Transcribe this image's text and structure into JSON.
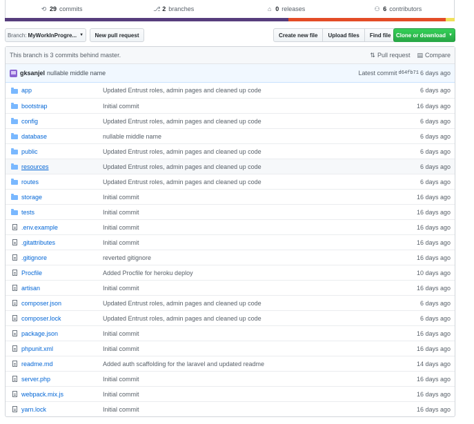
{
  "stats": {
    "commits_count": "29",
    "commits_label": "commits",
    "branches_count": "2",
    "branches_label": "branches",
    "releases_count": "0",
    "releases_label": "releases",
    "contributors_count": "6",
    "contributors_label": "contributors"
  },
  "language_bar": [
    {
      "color": "#563d7c",
      "fraction": 0.63
    },
    {
      "color": "#e34c26",
      "fraction": 0.35
    },
    {
      "color": "#f1e05a",
      "fraction": 0.02
    }
  ],
  "toolbar": {
    "branch_label": "Branch:",
    "branch_name": "MyWorkInProgre...",
    "new_pull_request": "New pull request",
    "create_new_file": "Create new file",
    "upload_files": "Upload files",
    "find_file": "Find file",
    "clone_download": "Clone or download"
  },
  "branch_status": {
    "text": "This branch is 3 commits behind master.",
    "pull_request": "Pull request",
    "compare": "Compare"
  },
  "latest_commit": {
    "author": "gksanjel",
    "message": "nullable middle name",
    "label": "Latest commit",
    "sha": "d64fb71",
    "age": "6 days ago"
  },
  "files": [
    {
      "type": "dir",
      "name": "app",
      "message": "Updated Entrust roles, admin pages and cleaned up code",
      "age": "6 days ago"
    },
    {
      "type": "dir",
      "name": "bootstrap",
      "message": "Initial commit",
      "age": "16 days ago"
    },
    {
      "type": "dir",
      "name": "config",
      "message": "Updated Entrust roles, admin pages and cleaned up code",
      "age": "6 days ago"
    },
    {
      "type": "dir",
      "name": "database",
      "message": "nullable middle name",
      "age": "6 days ago"
    },
    {
      "type": "dir",
      "name": "public",
      "message": "Updated Entrust roles, admin pages and cleaned up code",
      "age": "6 days ago"
    },
    {
      "type": "dir",
      "name": "resources",
      "message": "Updated Entrust roles, admin pages and cleaned up code",
      "age": "6 days ago"
    },
    {
      "type": "dir",
      "name": "routes",
      "message": "Updated Entrust roles, admin pages and cleaned up code",
      "age": "6 days ago"
    },
    {
      "type": "dir",
      "name": "storage",
      "message": "Initial commit",
      "age": "16 days ago"
    },
    {
      "type": "dir",
      "name": "tests",
      "message": "Initial commit",
      "age": "16 days ago"
    },
    {
      "type": "file",
      "name": ".env.example",
      "message": "Initial commit",
      "age": "16 days ago"
    },
    {
      "type": "file",
      "name": ".gitattributes",
      "message": "Initial commit",
      "age": "16 days ago"
    },
    {
      "type": "file",
      "name": ".gitignore",
      "message": "reverted gitignore",
      "age": "16 days ago"
    },
    {
      "type": "file",
      "name": "Procfile",
      "message": "Added Procfile for heroku deploy",
      "age": "10 days ago"
    },
    {
      "type": "file",
      "name": "artisan",
      "message": "Initial commit",
      "age": "16 days ago"
    },
    {
      "type": "file",
      "name": "composer.json",
      "message": "Updated Entrust roles, admin pages and cleaned up code",
      "age": "6 days ago"
    },
    {
      "type": "file",
      "name": "composer.lock",
      "message": "Updated Entrust roles, admin pages and cleaned up code",
      "age": "6 days ago"
    },
    {
      "type": "file",
      "name": "package.json",
      "message": "Initial commit",
      "age": "16 days ago"
    },
    {
      "type": "file",
      "name": "phpunit.xml",
      "message": "Initial commit",
      "age": "16 days ago"
    },
    {
      "type": "file",
      "name": "readme.md",
      "message": "Added auth scaffolding for the laravel and updated readme",
      "age": "14 days ago"
    },
    {
      "type": "file",
      "name": "server.php",
      "message": "Initial commit",
      "age": "16 days ago"
    },
    {
      "type": "file",
      "name": "webpack.mix.js",
      "message": "Initial commit",
      "age": "16 days ago"
    },
    {
      "type": "file",
      "name": "yarn.lock",
      "message": "Initial commit",
      "age": "16 days ago"
    }
  ]
}
